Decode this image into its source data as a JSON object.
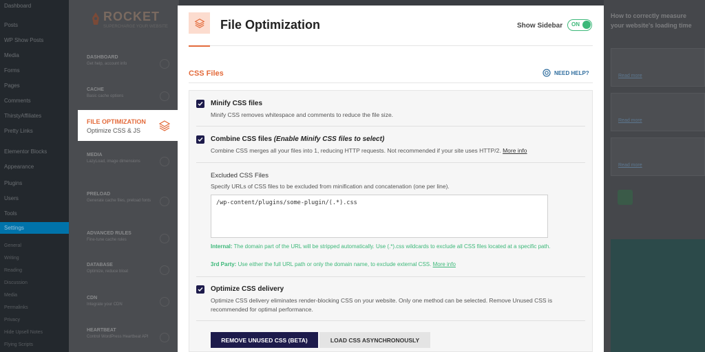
{
  "wp_menu": {
    "items": [
      "Dashboard",
      "Posts",
      "WP Show Posts",
      "Media",
      "Forms",
      "Pages",
      "Comments",
      "ThirstyAffiliates",
      "Pretty Links",
      "Elementor Blocks",
      "Appearance",
      "Plugins",
      "Users",
      "Tools",
      "Settings"
    ],
    "sub_items": [
      "General",
      "Writing",
      "Reading",
      "Discussion",
      "Media",
      "Permalinks",
      "Privacy",
      "Hide Upsell Notes",
      "Flying Scripts"
    ]
  },
  "rocket": {
    "logo": "ROCKET",
    "logo_sub": "SUPERCHARGE YOUR WEBSITE",
    "nav": [
      {
        "title": "DASHBOARD",
        "sub": "Get help, account info"
      },
      {
        "title": "CACHE",
        "sub": "Basic cache options"
      },
      {
        "title": "MEDIA",
        "sub": "LazyLoad, image dimensions"
      },
      {
        "title": "PRELOAD",
        "sub": "Generate cache files, preload fonts"
      },
      {
        "title": "ADVANCED RULES",
        "sub": "Fine-tune cache rules"
      },
      {
        "title": "DATABASE",
        "sub": "Optimize, reduce bloat"
      },
      {
        "title": "CDN",
        "sub": "Integrate your CDN"
      },
      {
        "title": "HEARTBEAT",
        "sub": "Control WordPress Heartbeat API"
      }
    ],
    "active_nav": {
      "title": "FILE OPTIMIZATION",
      "sub": "Optimize CSS & JS"
    }
  },
  "help": {
    "title": "How to correctly measure your website's loading time",
    "read_more": "Read more"
  },
  "header": {
    "title": "File Optimization",
    "sidebar_label": "Show Sidebar",
    "toggle_state": "ON"
  },
  "section": {
    "title": "CSS Files",
    "need_help": "NEED HELP?"
  },
  "options": {
    "minify": {
      "title": "Minify CSS files",
      "desc": "Minify CSS removes whitespace and comments to reduce the file size."
    },
    "combine": {
      "title": "Combine CSS files",
      "title_note": "(Enable Minify CSS files to select)",
      "desc": "Combine CSS merges all your files into 1, reducing HTTP requests. Not recommended if your site uses HTTP/2.",
      "more_info": "More info"
    },
    "excluded": {
      "title": "Excluded CSS Files",
      "desc": "Specify URLs of CSS files to be excluded from minification and concatenation (one per line).",
      "value": "/wp-content/plugins/some-plugin/(.*).css",
      "note_internal_label": "Internal:",
      "note_internal": "The domain part of the URL will be stripped automatically. Use (.*).css wildcards to exclude all CSS files located at a specific path.",
      "note_third_label": "3rd Party:",
      "note_third": "Use either the full URL path or only the domain name, to exclude external CSS.",
      "more_info": "More info"
    },
    "optimize_delivery": {
      "title": "Optimize CSS delivery",
      "desc": "Optimize CSS delivery eliminates render-blocking CSS on your website. Only one method can be selected. Remove Unused CSS is recommended for optimal performance."
    }
  },
  "buttons": {
    "remove_unused": "REMOVE UNUSED CSS (BETA)",
    "load_async": "LOAD CSS ASYNCHRONOUSLY"
  },
  "colors": {
    "accent": "#e36a3a",
    "primary": "#1d1b4b",
    "success": "#3cb879",
    "link": "#2f6d9e"
  }
}
